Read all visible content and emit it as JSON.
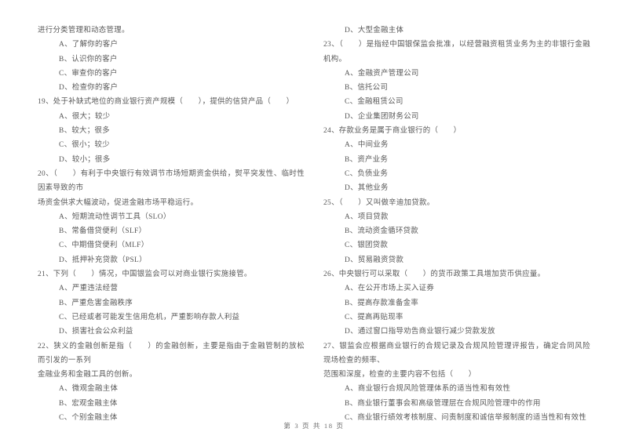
{
  "document": {
    "type": "exam-paper",
    "subject_hint": "银行从业资格考试 单项选择题",
    "page_footer": "第 3 页 共 18 页"
  },
  "left_column": {
    "carryover_line": "进行分类管理和动态管理。",
    "carryover_options": [
      "A、了解你的客户",
      "B、认识你的客户",
      "C、审查你的客户",
      "D、检查你的客户"
    ],
    "questions": [
      {
        "number": "19",
        "stem_lines": [
          "19、处于补缺式地位的商业银行资产规模（　　），提供的信贷产品（　　）"
        ],
        "options": [
          "A、很大；较少",
          "B、较大；很多",
          "C、很小；较少",
          "D、较小；很多"
        ]
      },
      {
        "number": "20",
        "stem_lines": [
          "20、（　　）有利于中央银行有效调节市场短期资金供给，熨平突发性、临时性因素导致的市",
          "场资金供求大幅波动，促进金融市场平稳运行。"
        ],
        "options": [
          "A、短期流动性调节工具（SLO）",
          "B、常备借贷便利（SLF）",
          "C、中期借贷便利（MLF）",
          "D、抵押补充贷款（PSL）"
        ]
      },
      {
        "number": "21",
        "stem_lines": [
          "21、下列（　　）情况，中国银监会可以对商业银行实施接管。"
        ],
        "options": [
          "A、严重违法经营",
          "B、严重危害金融秩序",
          "C、已经或者可能发生信用危机，严重影响存款人利益",
          "D、损害社会公众利益"
        ]
      },
      {
        "number": "22",
        "stem_lines": [
          "22、狭义的金融创新是指（　　）的金融创新，主要是指由于金融管制的放松而引发的一系列",
          "金融业务和金融工具的创新。"
        ],
        "options": [
          "A、微观金融主体",
          "B、宏观金融主体",
          "C、个别金融主体"
        ]
      }
    ]
  },
  "right_column": {
    "carryover_options": [
      "D、大型金融主体"
    ],
    "questions": [
      {
        "number": "23",
        "stem_lines": [
          "23、（　　）是指经中国银保监会批准，以经营融资租赁业务为主的非银行金融机构。"
        ],
        "options": [
          "A、金融资产管理公司",
          "B、信托公司",
          "C、金融租赁公司",
          "D、企业集团财务公司"
        ]
      },
      {
        "number": "24",
        "stem_lines": [
          "24、存款业务是属于商业银行的（　　）"
        ],
        "options": [
          "A、中间业务",
          "B、资产业务",
          "C、负债业务",
          "D、其他业务"
        ]
      },
      {
        "number": "25",
        "stem_lines": [
          "25、（　　）又叫做辛迪加贷款。"
        ],
        "options": [
          "A、项目贷款",
          "B、流动资金循环贷款",
          "C、银团贷款",
          "D、贸易融资贷款"
        ]
      },
      {
        "number": "26",
        "stem_lines": [
          "26、中央银行可以采取（　　）的货币政策工具增加货币供应量。"
        ],
        "options": [
          "A、在公开市场上买入证券",
          "B、提高存款准备金率",
          "C、提高再贴现率",
          "D、通过窗口指导劝告商业银行减少贷款发放"
        ]
      },
      {
        "number": "27",
        "stem_lines": [
          "27、银监会应根据商业银行的合规记录及合规风险管理评报告，确定合同风险现场检查的频率、",
          "范围和深度，检查的主要内容不包括（　　）"
        ],
        "options": [
          "A、商业银行合规风险管理体系的适当性和有效性",
          "B、商业银行董事会和高级管理层在合规风险管理中的作用",
          "C、商业银行绩效考核制度、问责制度和诚信举报制度的适当性和有效性"
        ]
      }
    ]
  }
}
